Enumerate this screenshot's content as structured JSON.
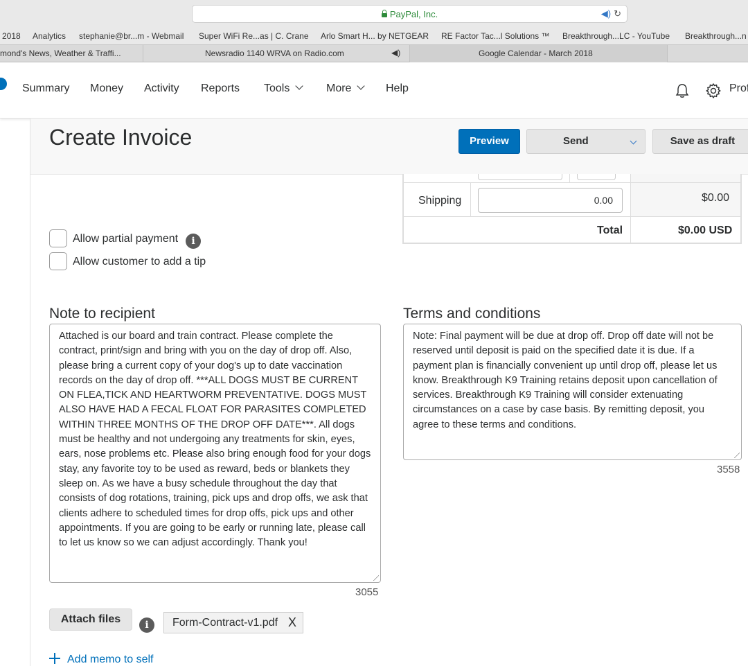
{
  "browser": {
    "address": "PayPal, Inc.",
    "bookmarks": [
      "2018",
      "Analytics",
      "stephanie@br...m - Webmail",
      "Super WiFi Re...as | C. Crane",
      "Arlo Smart H... by NETGEAR",
      "RE Factor Tac...l Solutions ™",
      "Breakthrough...LC - YouTube",
      "Breakthrough...n"
    ],
    "tabs": [
      "mond's News, Weather & Traffi...",
      "Newsradio 1140 WRVA on Radio.com",
      "Google Calendar - March 2018"
    ]
  },
  "nav": {
    "items": [
      "Summary",
      "Money",
      "Activity",
      "Reports",
      "Tools",
      "More",
      "Help"
    ],
    "profile": "Prof"
  },
  "page": {
    "title": "Create Invoice",
    "buttons": {
      "preview": "Preview",
      "send": "Send",
      "save_draft": "Save as draft"
    }
  },
  "totals": {
    "shipping_label": "Shipping",
    "shipping_value": "0.00",
    "shipping_amount": "$0.00",
    "total_label": "Total",
    "total_amount": "$0.00 USD"
  },
  "options": {
    "partial_payment": "Allow partial payment",
    "tip": "Allow customer to add a tip"
  },
  "note": {
    "label": "Note to recipient",
    "text": "Attached is our board and train contract. Please complete the contract, print/sign and bring with you on the day of drop off. Also, please bring a current copy of your dog's up to date vaccination records on the day of drop off. ***ALL DOGS MUST BE CURRENT ON FLEA,TICK AND HEARTWORM PREVENTATIVE. DOGS MUST ALSO HAVE HAD A FECAL FLOAT FOR PARASITES COMPLETED WITHIN THREE MONTHS OF THE DROP OFF DATE***. All dogs must be healthy and not undergoing any treatments for skin, eyes, ears, nose problems etc. Please also bring enough food for your dogs stay, any favorite toy to be used as reward, beds or blankets they sleep on. As we have a busy schedule throughout the day that consists of dog rotations, training, pick ups and drop offs, we ask that clients adhere to scheduled times for drop offs, pick ups and other appointments. If you are going to be early or running late, please call to let us know so we can adjust accordingly. Thank you!",
    "counter": "3055"
  },
  "terms": {
    "label": "Terms and conditions",
    "text": "Note: Final payment will be due at drop off. Drop off date will not be reserved until deposit is paid on the specified date it is due. If a payment plan is financially convenient up until drop off, please let us know. Breakthrough K9 Training retains deposit upon cancellation of services. Breakthrough K9 Training will consider extenuating circumstances on a case by case basis. By remitting deposit, you agree to these terms and conditions.",
    "counter": "3558"
  },
  "attach": {
    "button": "Attach files",
    "file": "Form-Contract-v1.pdf",
    "remove": "X",
    "memo": "Add memo to self"
  }
}
